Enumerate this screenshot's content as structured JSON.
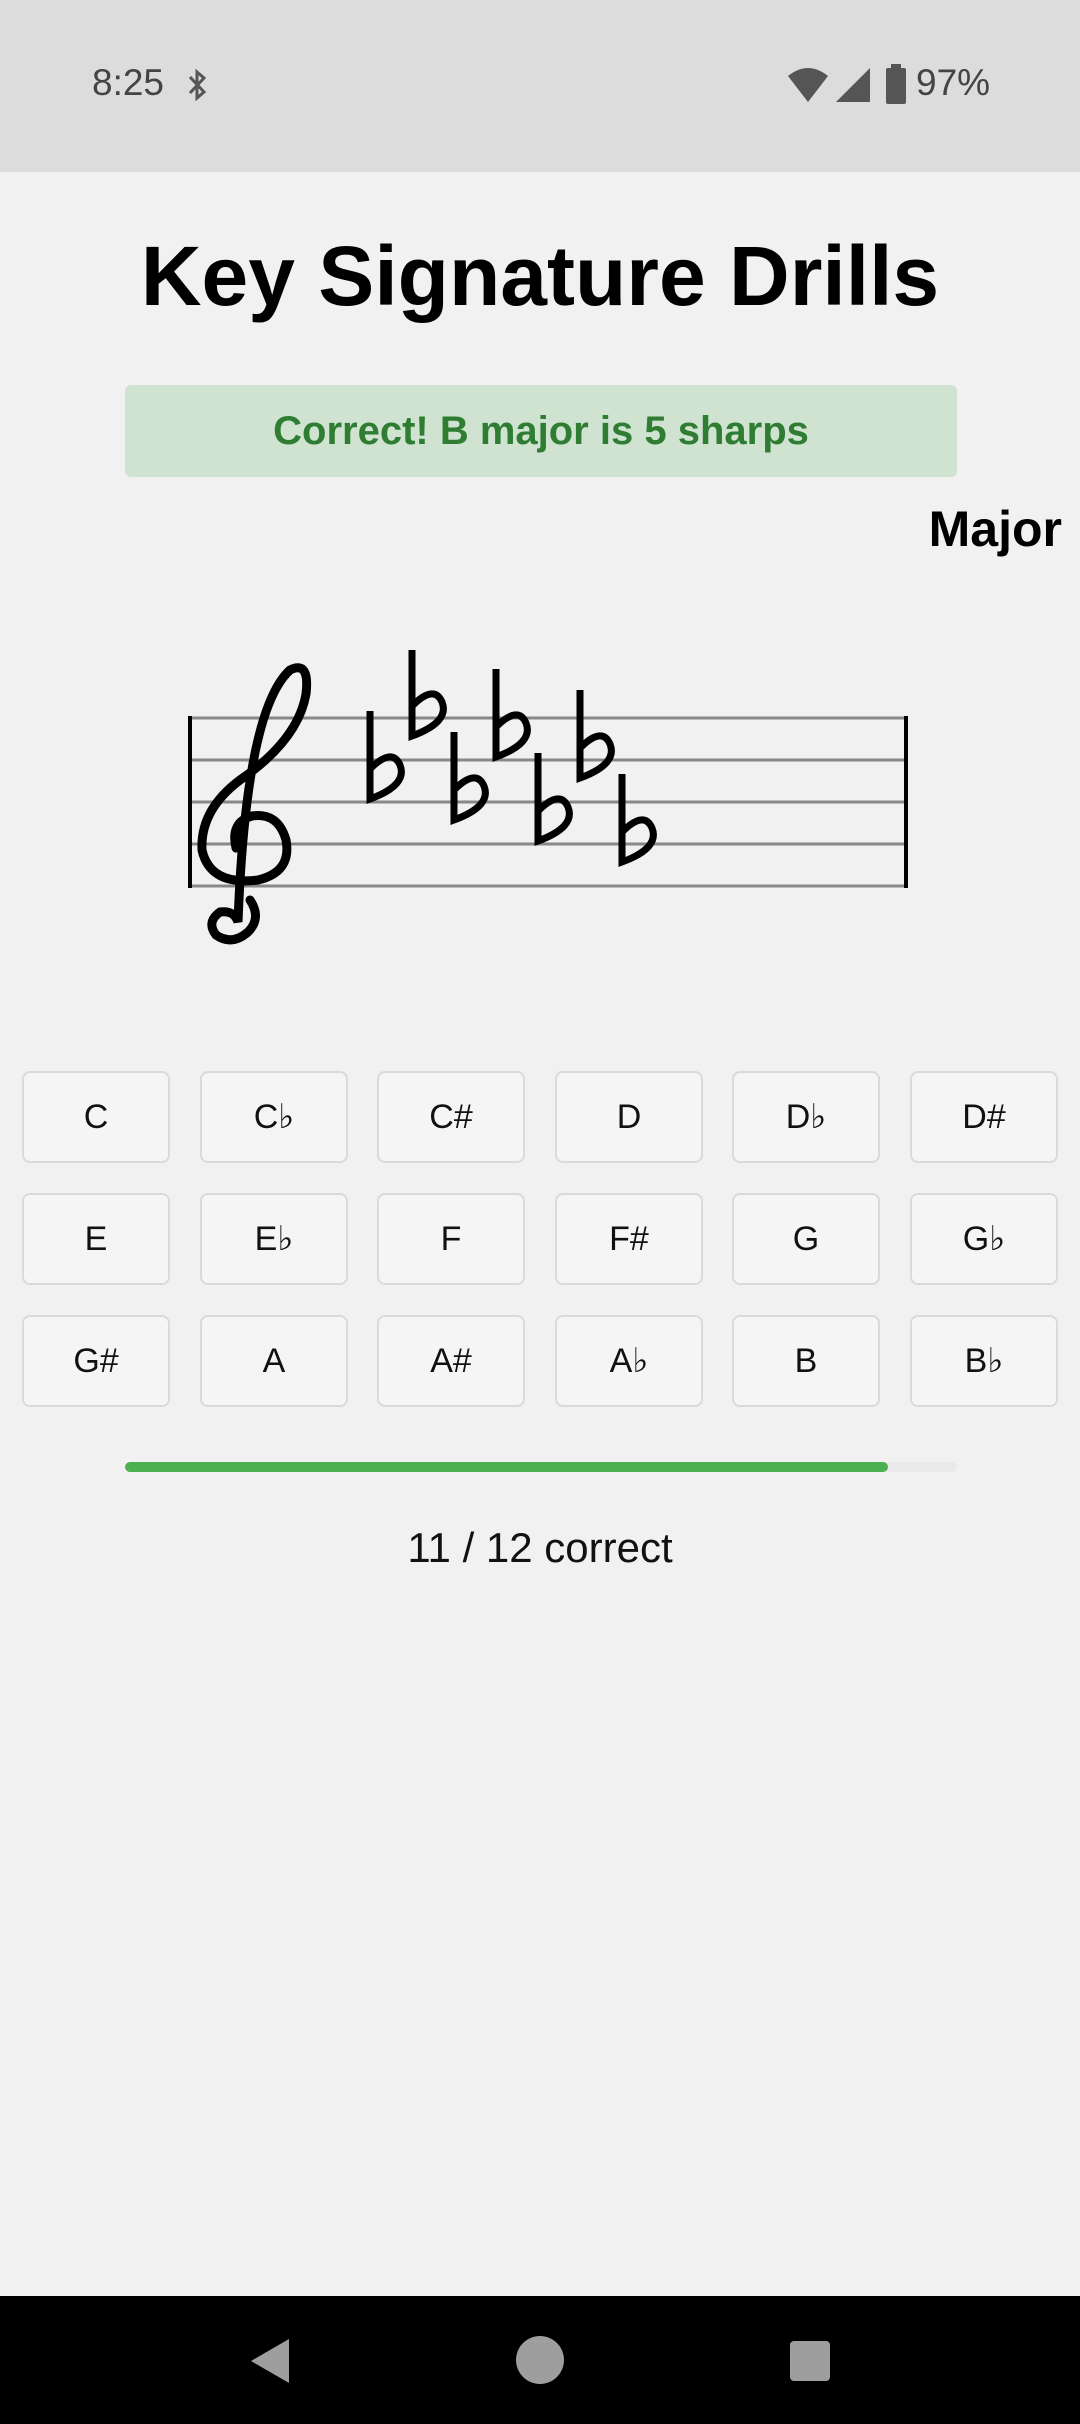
{
  "status": {
    "time": "8:25",
    "battery": "97%"
  },
  "app": {
    "title": "Key Signature Drills",
    "feedback": "Correct! B major is 5 sharps",
    "mode": "Major",
    "key_signature": {
      "clef": "treble",
      "accidental": "flat",
      "count": 7
    },
    "buttons": [
      [
        "C",
        "C♭",
        "C#",
        "D",
        "D♭",
        "D#"
      ],
      [
        "E",
        "E♭",
        "F",
        "F#",
        "G",
        "G♭"
      ],
      [
        "G#",
        "A",
        "A#",
        "A♭",
        "B",
        "B♭"
      ]
    ],
    "progress": {
      "correct": 11,
      "total": 12,
      "fraction": 0.917
    },
    "score_text": "11 / 12 correct"
  },
  "colors": {
    "accent": "#4caf50",
    "feedback_text": "#2e7d32",
    "feedback_bg": "#cfe3d0"
  }
}
